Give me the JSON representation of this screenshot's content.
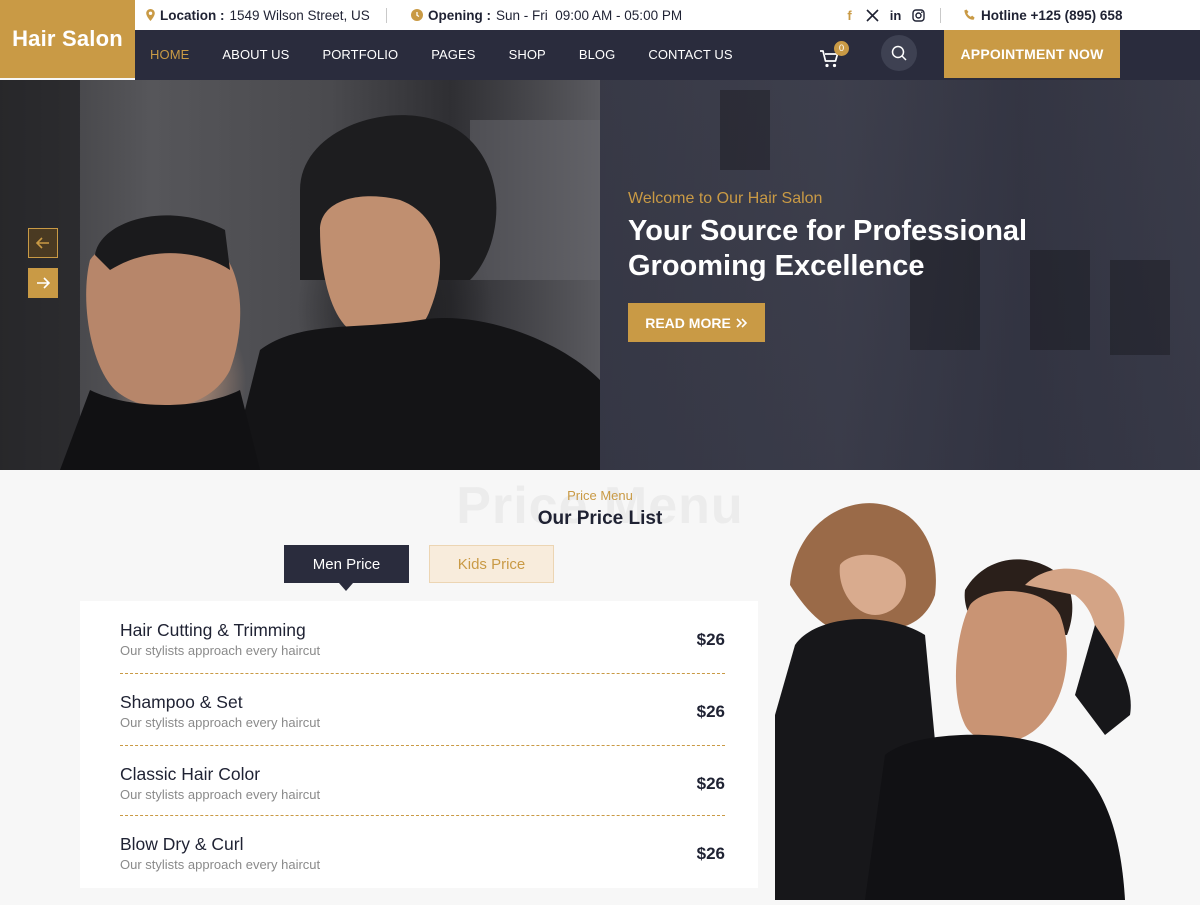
{
  "brand": {
    "name": "Hair Salon",
    "accent": "#c99a45",
    "dark": "#2a2c3d"
  },
  "topbar": {
    "location_label": "Location :",
    "location_value": "1549 Wilson Street, US",
    "opening_label": "Opening :",
    "opening_value": "Sun - Fri  09:00 AM - 05:00 PM",
    "social": [
      "facebook-icon",
      "x-icon",
      "linkedin-icon",
      "instagram-icon"
    ],
    "hotline": "Hotline +125 (895) 658"
  },
  "nav": {
    "items": [
      "HOME",
      "ABOUT US",
      "PORTFOLIO",
      "PAGES",
      "SHOP",
      "BLOG",
      "CONTACT US"
    ],
    "active": "HOME",
    "cart_count": "0",
    "appointment": "APPOINTMENT NOW"
  },
  "hero": {
    "subtitle": "Welcome to Our Hair Salon",
    "title": "Your Source for Professional Grooming Excellence",
    "button": "READ MORE"
  },
  "pricing": {
    "ghost": "Price Menu",
    "subtitle": "Price Menu",
    "title": "Our Price List",
    "tabs": [
      "Men Price",
      "Kids Price"
    ],
    "items": [
      {
        "name": "Hair Cutting & Trimming",
        "desc": "Our stylists approach every haircut",
        "price": "$26"
      },
      {
        "name": "Shampoo & Set",
        "desc": "Our stylists approach every haircut",
        "price": "$26"
      },
      {
        "name": "Classic Hair Color",
        "desc": "Our stylists approach every haircut",
        "price": "$26"
      },
      {
        "name": "Blow Dry & Curl",
        "desc": "Our stylists approach every haircut",
        "price": "$26"
      }
    ]
  }
}
